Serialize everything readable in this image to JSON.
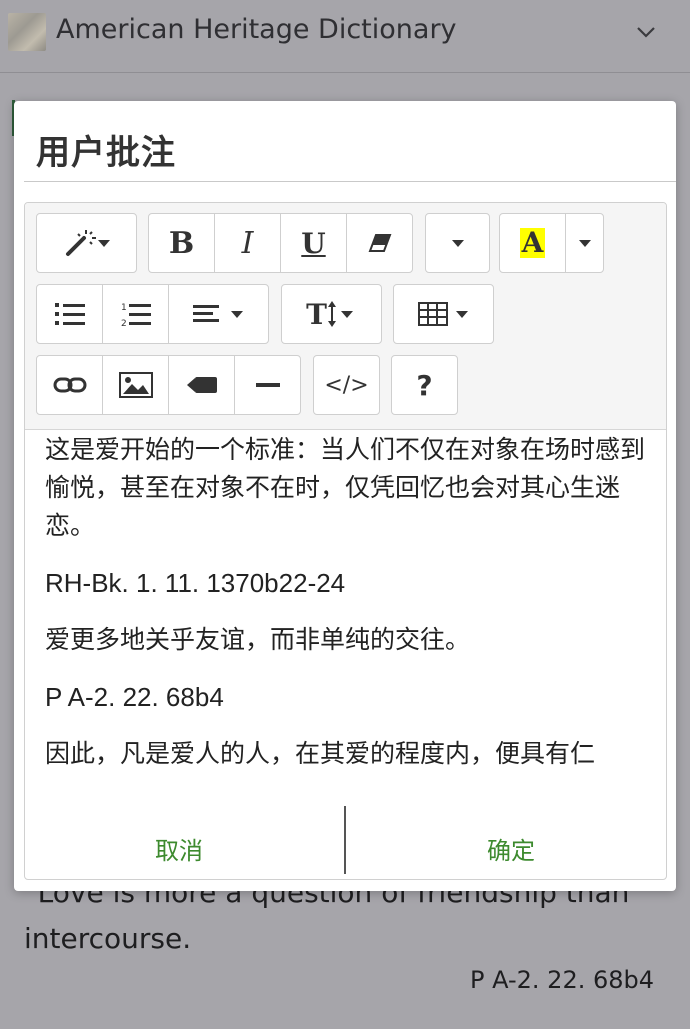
{
  "background": {
    "app_title": "American Heritage Dictionary",
    "text": "“Love is more a question of friendship than intercourse.",
    "reference": "P A-2. 22. 68b4"
  },
  "dialog": {
    "title": "用户批注",
    "toolbar": {
      "bold": "B",
      "italic": "I",
      "underline": "U",
      "highlight": "A",
      "font_size": "T",
      "help": "?",
      "code": "</>",
      "highlight_color": "#ffff00",
      "icons": [
        "magic-wand-icon",
        "bold-icon",
        "italic-icon",
        "underline-icon",
        "eraser-icon",
        "font-color-caret",
        "highlight-color-icon",
        "unordered-list-icon",
        "ordered-list-icon",
        "align-icon",
        "font-size-icon",
        "table-icon",
        "link-icon",
        "picture-icon",
        "video-icon",
        "horizontal-rule-icon",
        "code-view-icon",
        "help-icon"
      ]
    },
    "content": [
      "这是爱开始的一个标准：当人们不仅在对象在场时感到愉悦，甚至在对象不在时，仅凭回忆也会对其心生迷恋。",
      "RH-Bk. 1. 11. 1370b22-24",
      "爱更多地关乎友谊，而非单纯的交往。",
      "P A-2. 22. 68b4",
      "因此，凡是爱人的人，在其爱的程度内，便具有仁"
    ],
    "cancel_label": "取消",
    "confirm_label": "确定",
    "accent_color": "#3d8a2e"
  }
}
